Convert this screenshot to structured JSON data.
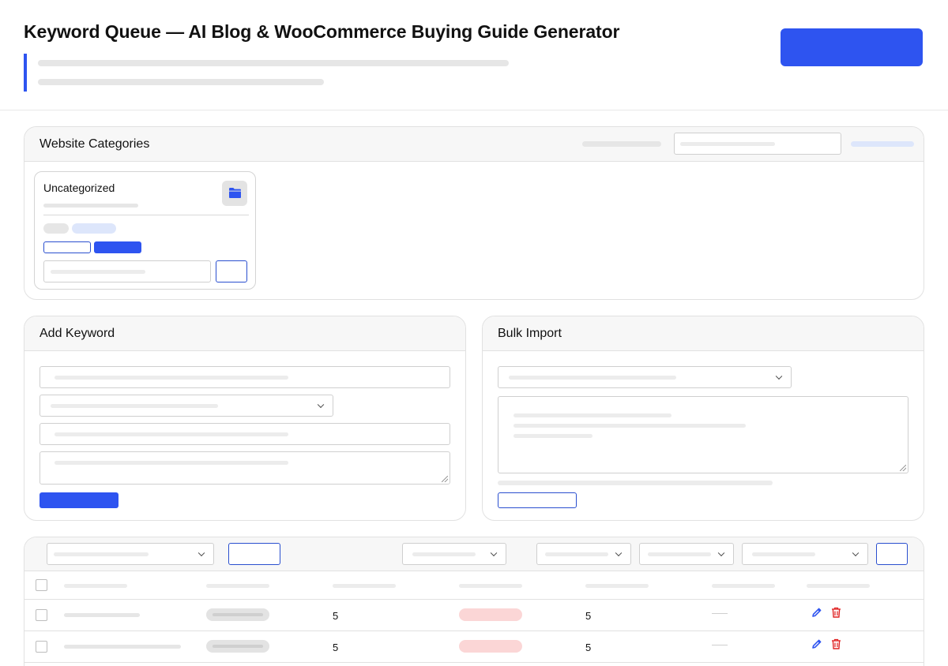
{
  "header": {
    "title": "Keyword Queue — AI Blog & WooCommerce Buying Guide Generator"
  },
  "categories_panel": {
    "title": "Website Categories",
    "category": {
      "name": "Uncategorized",
      "icon": "folder-icon"
    }
  },
  "add_keyword": {
    "title": "Add Keyword"
  },
  "bulk_import": {
    "title": "Bulk Import"
  },
  "table": {
    "rows": [
      {
        "col3": "5",
        "col5": "5"
      },
      {
        "col3": "5",
        "col5": "5"
      }
    ]
  },
  "colors": {
    "accent": "#2e54f0",
    "danger": "#e02424",
    "edit": "#2e54f0"
  }
}
